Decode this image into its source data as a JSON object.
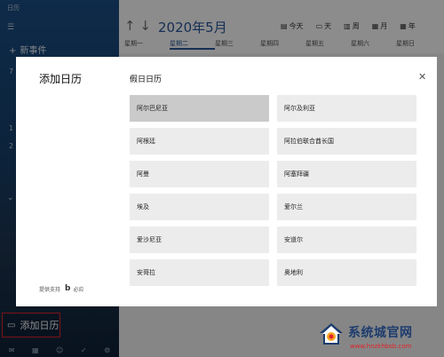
{
  "app": {
    "title": "日历"
  },
  "sidebar": {
    "menu_icon": "hamburger-icon",
    "new_event_label": "新事件",
    "side_digits": [
      "7",
      "1",
      "2"
    ],
    "add_calendar_label": "添加日历",
    "add_calendar_icon": "calendar-add-icon",
    "bottom_icons": [
      "mail-icon",
      "calendar-icon",
      "people-icon",
      "check-icon",
      "settings-icon"
    ]
  },
  "header": {
    "month_label": "2020年5月",
    "views": [
      {
        "icon": "today-icon",
        "label": "今天"
      },
      {
        "icon": "day-icon",
        "label": "天"
      },
      {
        "icon": "week-icon",
        "label": "周"
      },
      {
        "icon": "month-icon",
        "label": "月"
      },
      {
        "icon": "year-icon",
        "label": "年"
      }
    ],
    "weekdays": [
      "星期一",
      "星期二",
      "星期三",
      "星期四",
      "星期五",
      "星期六",
      "星期日"
    ],
    "active_weekday_index": 1
  },
  "dialog": {
    "title": "添加日历",
    "section_title": "假日日历",
    "close_icon": "close-icon",
    "powered_by": "提供支持",
    "powered_brand": "必应",
    "holiday_calendars": [
      "阿尔巴尼亚",
      "阿尔及利亚",
      "阿根廷",
      "阿拉伯联合酋长国",
      "阿曼",
      "阿塞拜疆",
      "埃及",
      "爱尔兰",
      "爱沙尼亚",
      "安道尔",
      "安哥拉",
      "奥地利"
    ],
    "selected_index": 0
  },
  "watermark": {
    "name": "系统城官网",
    "url": "www.hnzkhbsb.com",
    "colors": {
      "red": "#e0242b",
      "navy": "#1d3c6e",
      "orange": "#f5a623"
    }
  }
}
